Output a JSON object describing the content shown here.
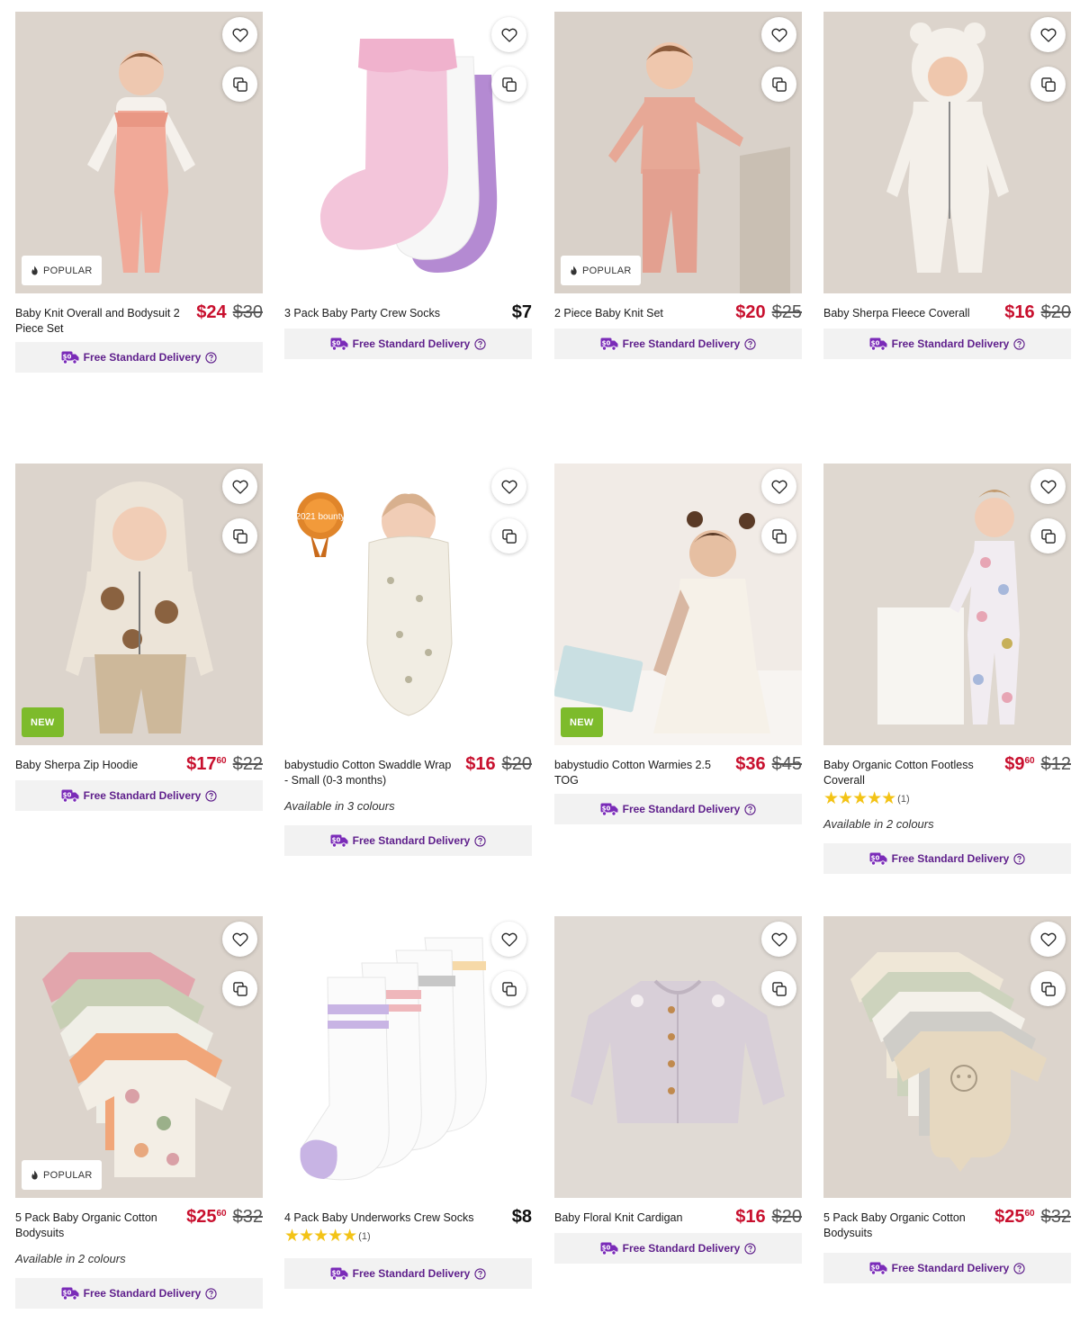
{
  "ui": {
    "delivery_label": "Free Standard Delivery",
    "popular_label": "POPULAR",
    "new_label": "NEW",
    "stars": "★★★★★"
  },
  "products": [
    {
      "title": "Baby Knit Overall and Bodysuit 2 Piece Set",
      "price": "$24",
      "was": "$30",
      "badge": "POPULAR"
    },
    {
      "title": "3 Pack Baby Party Crew Socks",
      "price": "$7"
    },
    {
      "title": "2 Piece Baby Knit Set",
      "price": "$20",
      "was": "$25",
      "badge": "POPULAR"
    },
    {
      "title": "Baby Sherpa Fleece Coverall",
      "price": "$16",
      "was": "$20"
    },
    {
      "title": "Baby Sherpa Zip Hoodie",
      "price": "$17",
      "cents": "60",
      "was": "$22",
      "badge": "NEW"
    },
    {
      "title": "babystudio Cotton Swaddle Wrap - Small (0-3 months)",
      "price": "$16",
      "was": "$20",
      "colours": "Available in 3 colours",
      "award": "2021 bounty"
    },
    {
      "title": "babystudio Cotton Warmies 2.5 TOG",
      "price": "$36",
      "was": "$45",
      "badge": "NEW"
    },
    {
      "title": "Baby Organic Cotton Footless Coverall",
      "price": "$9",
      "cents": "60",
      "was": "$12",
      "rating_count": "(1)",
      "colours": "Available in 2 colours"
    },
    {
      "title": "5 Pack Baby Organic Cotton Bodysuits",
      "price": "$25",
      "cents": "60",
      "was": "$32",
      "badge": "POPULAR",
      "colours": "Available in 2 colours"
    },
    {
      "title": "4 Pack Baby Underworks Crew Socks",
      "price": "$8",
      "rating_count": "(1)"
    },
    {
      "title": "Baby Floral Knit Cardigan",
      "price": "$16",
      "was": "$20"
    },
    {
      "title": "5 Pack Baby Organic Cotton Bodysuits",
      "price": "$25",
      "cents": "60",
      "was": "$32"
    }
  ],
  "colors": {
    "sale_red": "#c8102e",
    "delivery_purple": "#5e1e8b",
    "new_green": "#7dbb2b",
    "star_yellow": "#f3c316"
  }
}
